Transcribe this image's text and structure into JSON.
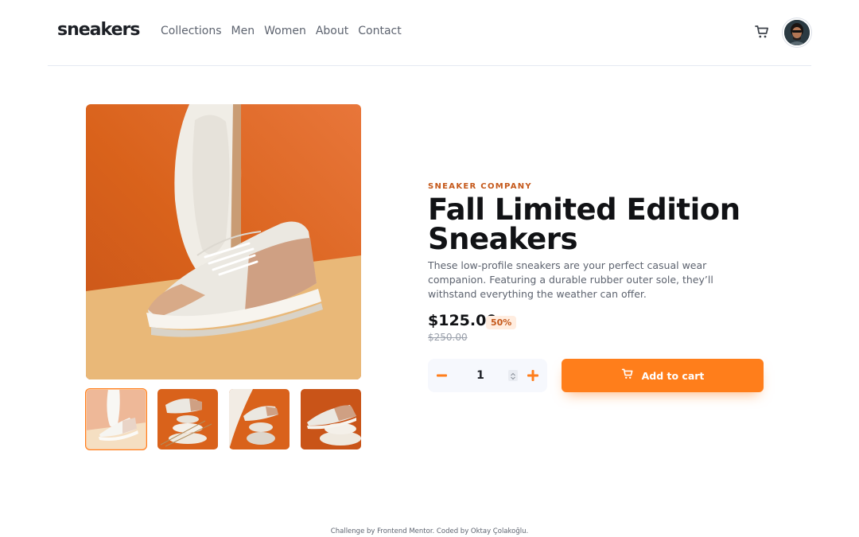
{
  "header": {
    "logo": "sneakers",
    "nav": [
      "Collections",
      "Men",
      "Women",
      "About",
      "Contact"
    ],
    "cart_icon": "cart-icon",
    "avatar_icon": "user-avatar"
  },
  "product": {
    "company": "SNEAKER COMPANY",
    "title": "Fall Limited Edition Sneakers",
    "description": "These low-profile sneakers are your perfect casual wear companion. Featuring a durable rubber outer sole, they’ll withstand everything the weather can offer.",
    "price": "$125.00",
    "discount": "50%",
    "old_price": "$250.00",
    "quantity": "1",
    "add_to_cart": "Add to cart"
  },
  "gallery": {
    "selected_index": 0,
    "thumbnails": 4
  },
  "colors": {
    "accent": "#ff7e1b",
    "accent_dark": "#c5581a",
    "accent_pale": "#ffede0",
    "text_dark": "#111215",
    "text_muted": "#5d636f"
  },
  "footer": {
    "text": "Challenge by Frontend Mentor. Coded by Oktay Çolakoğlu."
  }
}
